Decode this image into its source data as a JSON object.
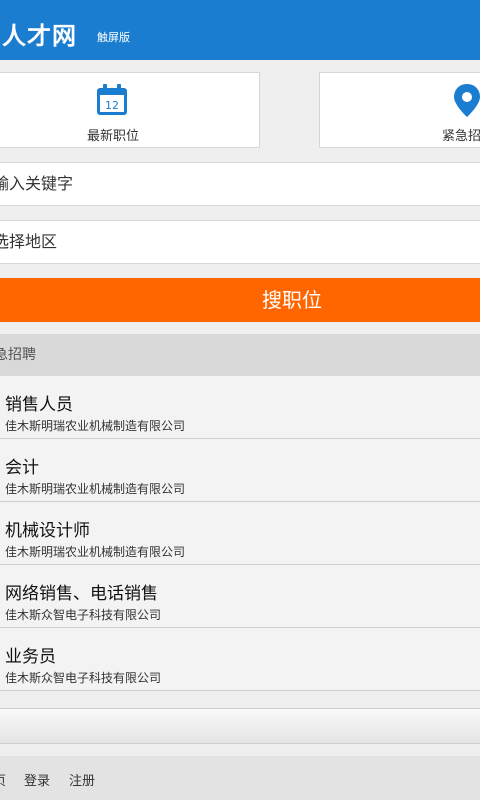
{
  "header": {
    "logo": "人才网",
    "subtitle": "触屏版"
  },
  "quick_links": [
    {
      "label": "最新职位",
      "icon": "calendar-icon",
      "icon_text": "12"
    },
    {
      "label": "紧急招",
      "icon": "location-pin-icon"
    }
  ],
  "search": {
    "keyword_placeholder": "输入关键字",
    "area_placeholder": "选择地区",
    "button_label": "搜职位"
  },
  "section": {
    "title": "急招聘"
  },
  "jobs": [
    {
      "title": "销售人员",
      "company": "佳木斯明瑞农业机械制造有限公司"
    },
    {
      "title": "会计",
      "company": "佳木斯明瑞农业机械制造有限公司"
    },
    {
      "title": "机械设计师",
      "company": "佳木斯明瑞农业机械制造有限公司"
    },
    {
      "title": "网络销售、电话销售",
      "company": "佳木斯众智电子科技有限公司"
    },
    {
      "title": "业务员",
      "company": "佳木斯众智电子科技有限公司"
    }
  ],
  "footer": {
    "home": "页",
    "login": "登录",
    "register": "注册"
  },
  "colors": {
    "header_bg": "#1a7dcf",
    "accent_orange": "#ff6600",
    "icon_blue": "#1a7dcf"
  }
}
